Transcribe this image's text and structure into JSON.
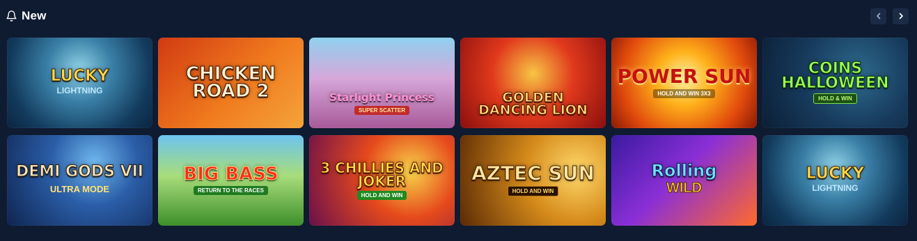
{
  "header": {
    "title": "New",
    "title_icon": "bell-icon",
    "prev_icon": "chevron-left-icon",
    "next_icon": "chevron-right-icon"
  },
  "colors": {
    "background": "#0f1b31",
    "nav_button": "#1b2b45"
  },
  "games": [
    {
      "title": "LUCKY",
      "subtitle": "LIGHTNING"
    },
    {
      "title": "CHICKEN ROAD 2",
      "subtitle": ""
    },
    {
      "title": "Starlight Princess",
      "subtitle": "SUPER SCATTER"
    },
    {
      "title": "GOLDEN DANCING LION",
      "subtitle": ""
    },
    {
      "title": "POWER SUN",
      "subtitle": "HOLD AND WIN 3X3"
    },
    {
      "title": "COINS HALLOWEEN",
      "subtitle": "HOLD & WIN"
    },
    {
      "title": "DEMI GODS VII",
      "subtitle": "ULTRA MODE"
    },
    {
      "title": "BIG BASS",
      "subtitle": "RETURN TO THE RACES"
    },
    {
      "title": "3 CHILLIES AND JOKER",
      "subtitle": "HOLD AND WIN"
    },
    {
      "title": "AZTEC SUN",
      "subtitle": "HOLD AND WIN"
    },
    {
      "title": "Rolling",
      "subtitle": "WILD"
    },
    {
      "title": "LUCKY",
      "subtitle": "LIGHTNING"
    }
  ]
}
